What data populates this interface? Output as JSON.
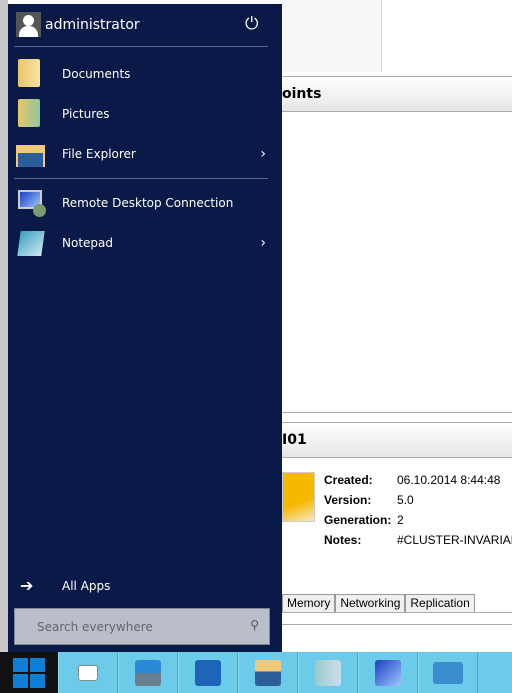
{
  "start_menu": {
    "user": "administrator",
    "items": [
      {
        "label": "Documents",
        "icon": "documents-folder-icon"
      },
      {
        "label": "Pictures",
        "icon": "pictures-folder-icon"
      },
      {
        "label": "File Explorer",
        "icon": "file-explorer-icon",
        "submenu": true
      },
      {
        "label": "Remote Desktop Connection",
        "icon": "remote-desktop-icon"
      },
      {
        "label": "Notepad",
        "icon": "notepad-icon",
        "submenu": true
      }
    ],
    "all_apps": "All Apps",
    "search_placeholder": "Search everywhere"
  },
  "background": {
    "header1": "oints",
    "header2": "I01",
    "props": [
      {
        "k": "Created:",
        "v": "06.10.2014 8:44:48"
      },
      {
        "k": "Version:",
        "v": "5.0"
      },
      {
        "k": "Generation:",
        "v": "2"
      },
      {
        "k": "Notes:",
        "v": "#CLUSTER-INVARIANT"
      }
    ],
    "tabs": [
      "Memory",
      "Networking",
      "Replication"
    ]
  },
  "taskbar": [
    "task-view",
    "server-manager",
    "powershell",
    "file-explorer",
    "hyper-v-manager",
    "network-computer",
    "powershell-ise"
  ],
  "colors": {
    "start_bg": "#0a1a48",
    "taskbar": "#6ccbe8",
    "windows_logo": "#0c7fd6"
  }
}
